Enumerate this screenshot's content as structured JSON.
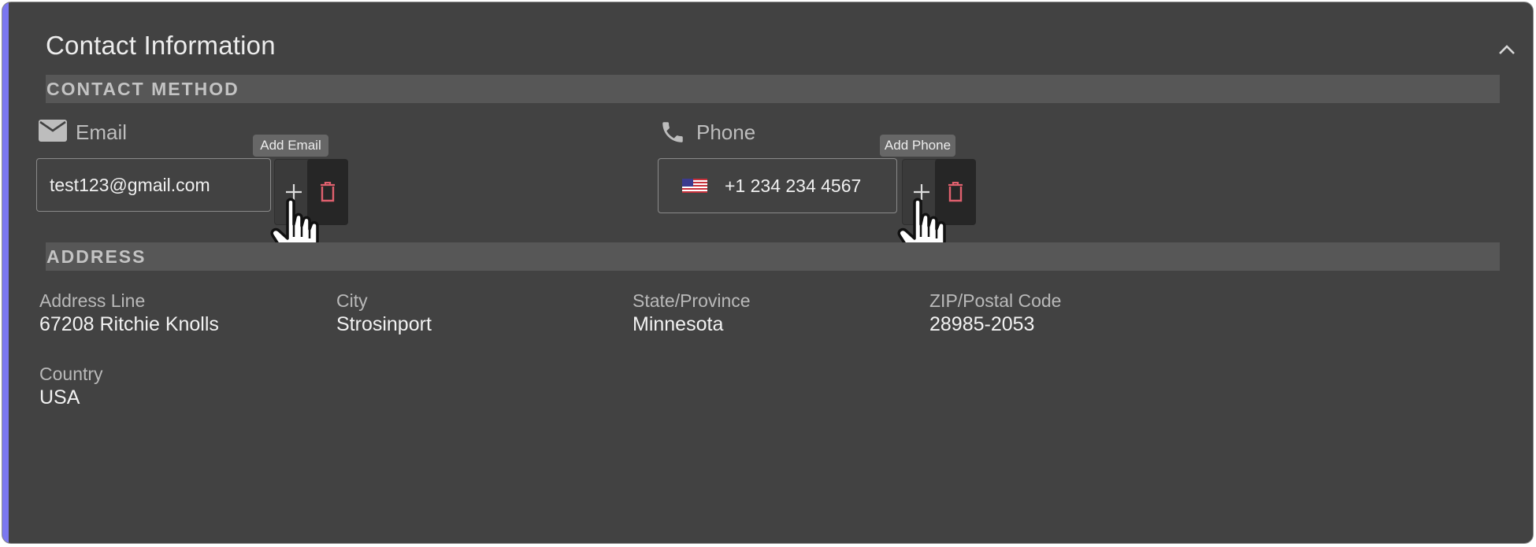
{
  "card": {
    "title": "Contact Information",
    "accent_color": "#7b77f0",
    "collapse_icon": "chevron-up-icon"
  },
  "contact_method": {
    "header": "CONTACT METHOD",
    "email": {
      "label": "Email",
      "icon": "mail-icon",
      "value": "test123@gmail.com",
      "add_tooltip": "Add Email"
    },
    "phone": {
      "label": "Phone",
      "icon": "phone-icon",
      "country_flag": "us-flag-icon",
      "value": "+1 234 234 4567",
      "add_tooltip": "Add Phone"
    },
    "delete_icon_color": "#e0606e"
  },
  "address": {
    "header": "ADDRESS",
    "fields": [
      {
        "label": "Address Line",
        "value": "67208 Ritchie Knolls"
      },
      {
        "label": "City",
        "value": "Strosinport"
      },
      {
        "label": "State/Province",
        "value": "Minnesota"
      },
      {
        "label": "ZIP/Postal Code",
        "value": "28985-2053"
      },
      {
        "label": "Country",
        "value": "USA"
      }
    ]
  }
}
